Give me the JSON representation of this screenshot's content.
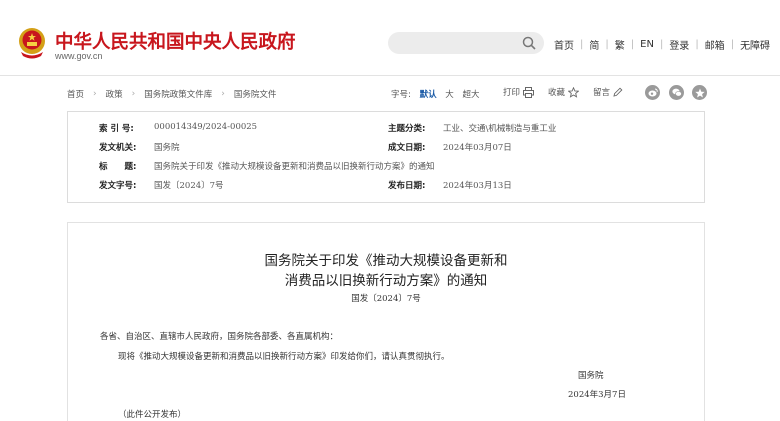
{
  "site": {
    "title": "中华人民共和国中央人民政府",
    "url": "www.gov.cn"
  },
  "topnav": [
    "首页",
    "简",
    "繁",
    "EN",
    "登录",
    "邮箱",
    "无障碍"
  ],
  "breadcrumb": [
    "首页",
    "政策",
    "国务院政策文件库",
    "国务院文件"
  ],
  "fontsize": {
    "label": "字号:",
    "options": [
      "默认",
      "大",
      "超大"
    ]
  },
  "tools": [
    "打印",
    "收藏",
    "留言"
  ],
  "meta": {
    "index_label": "索 引 号:",
    "index_value": "000014349/2024-00025",
    "topic_label": "主题分类:",
    "topic_value": "工业、交通\\机械制造与重工业",
    "issuer_label": "发文机关:",
    "issuer_value": "国务院",
    "created_label": "成文日期:",
    "created_value": "2024年03月07日",
    "title_label": "标　　题:",
    "title_value": "国务院关于印发《推动大规模设备更新和消费品以旧换新行动方案》的通知",
    "docno_label": "发文字号:",
    "docno_value": "国发〔2024〕7号",
    "published_label": "发布日期:",
    "published_value": "2024年03月13日"
  },
  "document": {
    "title_line1": "国务院关于印发《推动大规模设备更新和",
    "title_line2": "消费品以旧换新行动方案》的通知",
    "doc_number": "国发〔2024〕7号",
    "recipients": "各省、自治区、直辖市人民政府，国务院各部委、各直属机构：",
    "body": "现将《推动大规模设备更新和消费品以旧换新行动方案》印发给你们，请认真贯彻执行。",
    "signature": "国务院",
    "date": "2024年3月7日",
    "note": "（此件公开发布）"
  },
  "colors": {
    "brand_red": "#c8161d",
    "active_blue": "#1a5aa6"
  }
}
